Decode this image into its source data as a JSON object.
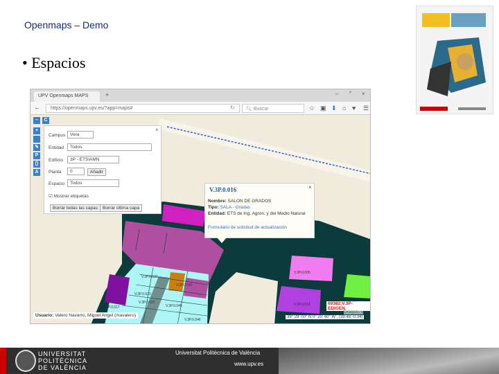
{
  "slide": {
    "title": "Openmaps – Demo",
    "bullet": "Espacios"
  },
  "browser": {
    "tab_title": "UPV Openmaps MAPS",
    "url": "https://openmaps.upv.es/?app=maps#",
    "search_placeholder": "Buscar"
  },
  "toolbar": {
    "buttons": [
      "–",
      "C",
      "+",
      "",
      "✎",
      "P",
      "()",
      "A"
    ]
  },
  "panel": {
    "close": "x",
    "fields": [
      {
        "label": "Campus",
        "value": "Vera"
      },
      {
        "label": "Entidad",
        "value": "Todos"
      },
      {
        "label": "Edificio",
        "value": "3P - ETSIAMN"
      },
      {
        "label": "Planta",
        "value": "0"
      },
      {
        "label": "Espacio",
        "value": "Todos"
      }
    ],
    "add_button": "Añadir",
    "show_labels": "Mostrar etiquetas",
    "clear_all": "Borrar todas las capas",
    "clear_last": "Borrar última capa"
  },
  "popup": {
    "title": "V.3P.0.016",
    "close": "x",
    "nombre_label": "Nombre:",
    "nombre": "SALON DE GRADOS",
    "tipo_label": "Tipo:",
    "tipo": "SALA - Gradas",
    "entidad_label": "Entidad:",
    "entidad": "ETS de Ing. Agron. y del Medio Natural",
    "link": "Formulario de solicitud de actualización"
  },
  "map_labels": [
    "V.3P.0.005",
    "V.3P.0.014",
    "V.3P.0.047",
    "V.3P.0.046",
    "V.3P.0.045",
    "V.3P.0.023",
    "V.3P.0.025",
    "V.3P.0.030",
    "V.3P.0.017"
  ],
  "status": {
    "user_label": "Usuario:",
    "user": "Valero Navarro, Miguel Angel (mavalero)",
    "code": "69382;V.3P-EDIGEN",
    "dragon": "Dragon, y",
    "coords": "39° 29' 00'' N 0° 20' 40'' W , (39.48,-0.34)"
  },
  "footer": {
    "logo": "UNIVERSITAT POLITÈCNICA DE VALÈNCIA",
    "university": "Universitat Politècnica de València",
    "website": "www.upv.es"
  }
}
